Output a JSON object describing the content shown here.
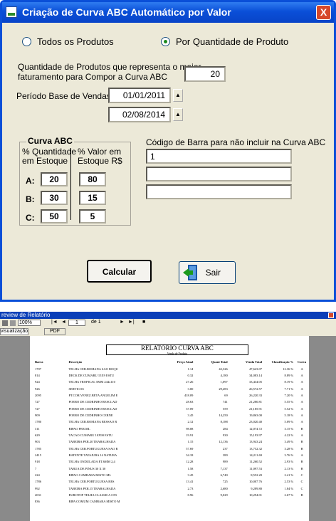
{
  "dialog": {
    "title": "Criação de Curva ABC Automático por Valor",
    "close_label": "X",
    "radio_all": "Todos os Produtos",
    "radio_qty": "Por Quantidade de Produto",
    "qty_label_line1": "Quantidade de Produtos que representa o maior",
    "qty_label_line2": "faturamento para Compor a Curva ABC",
    "qty_value": "20",
    "period_label": "Período Base de Vendas",
    "date_from": "01/01/2011",
    "date_to": "02/08/2014",
    "barcode_label": "Código de Barra para não incluir na Curva ABC",
    "barcode_values": [
      "1",
      "",
      ""
    ],
    "curve_title": "Curva ABC",
    "col_qty_line1": "% Quantidade",
    "col_qty_line2": "em Estoque",
    "col_val_line1": "% Valor em",
    "col_val_line2": "Estoque R$",
    "rows": [
      {
        "label": "A:",
        "qty": "20",
        "val": "80"
      },
      {
        "label": "B:",
        "qty": "30",
        "val": "15"
      },
      {
        "label": "C:",
        "qty": "50",
        "val": "5"
      }
    ],
    "calc_button": "Calcular",
    "exit_button": "Sair"
  },
  "report": {
    "window_title": "review de Relatório",
    "zoom": "100%",
    "page_current": "1",
    "page_total": "de 1",
    "tab_view": "visualização",
    "tab_pdf": "PDF",
    "heading": "RELATÓRIO CURVA ABC",
    "subheading": "Venda de Produto",
    "columns": [
      "Barra",
      "Descrição",
      "Preço Atual",
      "Quant Total",
      "Venda Total",
      "Classificação %",
      "Curva"
    ],
    "rows": [
      [
        "1707",
        "TELHA CER.ROMANA SAO ROQU",
        "1.14",
        "42,326",
        "47,623.07",
        "12.36 %",
        "A"
      ],
      [
        "814",
        "DECK DE CUMARU 15X9 ESTU",
        "0.32",
        "4,180",
        "34,083.14",
        "8.89 %",
        "A"
      ],
      [
        "924",
        "TELHA TROPICAL 5MM 244x110",
        "27.26",
        "1,097",
        "33,434.05",
        "8.19 %",
        "A"
      ],
      [
        "926",
        "SERVICOS",
        "3.00",
        "29,283",
        "26,572.57",
        "7.71 %",
        "A"
      ],
      [
        "2095",
        "PT.COR.VENEZ.BETA ANGELIM E",
        "418.09",
        "69",
        "26,220.33",
        "7.20 %",
        "A"
      ],
      [
        "727",
        "POERO DE CEDRINHO RESCLAD",
        "28.63",
        "741",
        "21,280.81",
        "5.55 %",
        "A"
      ],
      [
        "727",
        "POERO DE CEDRINHO RESCLAD",
        "37.09",
        "559",
        "21,185.91",
        "5.52 %",
        "A"
      ],
      [
        "909",
        "POERO DE CEDRINHO CERNE",
        "3.45",
        "14,250",
        "19,863.00",
        "5.18 %",
        "A"
      ],
      [
        "1780",
        "TELHA CER.ROMANA RESSAO R",
        "2.12",
        "8,188",
        "23,020.40",
        "5.09 %",
        "A"
      ],
      [
        "311",
        "RIPAO PER.ML",
        "98.08",
        "284",
        "12,074.72",
        "3.15 %",
        "B"
      ],
      [
        "629",
        "TACAO CUMARU 10X90 ESTU",
        "19.91",
        "930",
        "15,193.97",
        "4.22 %",
        "A"
      ],
      [
        "903",
        "TABEIRA PER.20 TRABALHADA",
        "1.15",
        "12,136",
        "13,943.24",
        "3.49 %",
        "B"
      ],
      [
        "1785",
        "TELHA CER.PORTUGUESA SAO R",
        "57.69",
        "237",
        "13,752.32",
        "3.28 %",
        "B"
      ],
      [
        "2415",
        "BATENTE TATAJUBA 14 NATURA",
        "34.18",
        "389",
        "14,211.69",
        "3.76 %",
        "A"
      ],
      [
        "918",
        "TELHA ONDULADA ET.6MM 2,4",
        "12.28",
        "989",
        "11,260.52",
        "2.93 %",
        "B"
      ],
      [
        "7",
        "TABUA DE PINUS 30 X 30",
        "1.58",
        "7,137",
        "11,097.53",
        "2.13 %",
        "B"
      ],
      [
        "224",
        "RIPAO CAMBARA MISTO ML",
        "3.45",
        "6,740",
        "8,552.20",
        "2.41 %",
        "C"
      ],
      [
        "1786",
        "TELHA CER.PORTUGUESA RES",
        "13.41",
        "725",
        "10,007.76",
        "2.53 %",
        "C"
      ],
      [
        "992",
        "TABEIRA PER.15 TRABALHADA",
        "2.73",
        "2,680",
        "9,289.80",
        "1.84 %",
        "C"
      ],
      [
        "2031",
        "EUROTOP TELHA CLASSICA CIN",
        "8.96",
        "9,029",
        "10,294.01",
        "2.67 %",
        "B"
      ],
      [
        "836",
        "RIPA COMUM CAMBARA MISTO M",
        "",
        "",
        "",
        "",
        ""
      ]
    ]
  }
}
